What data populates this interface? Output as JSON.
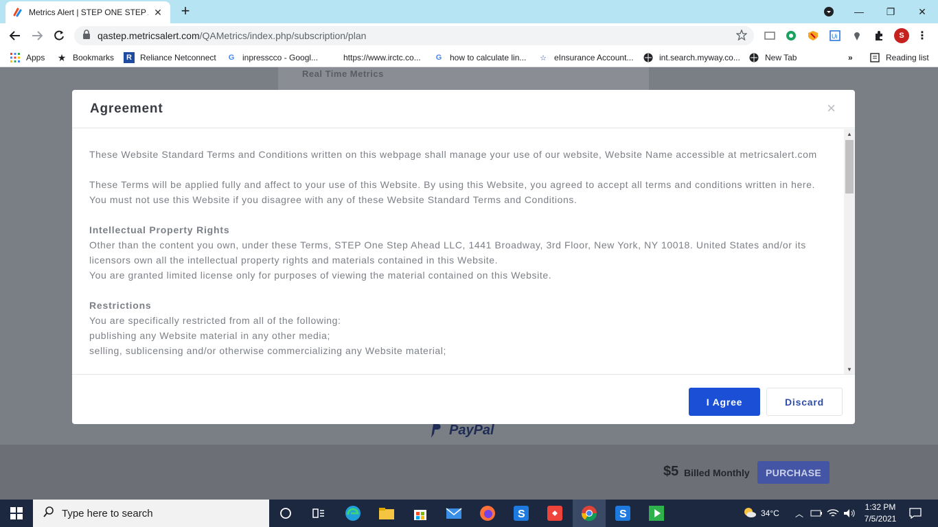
{
  "browser": {
    "tab_title": "Metrics Alert | STEP ONE STEP AHEAD",
    "url_host": "qastep.metricsalert.com",
    "url_path": "/QAMetrics/index.php/subscription/plan"
  },
  "bookmarks": [
    {
      "label": "Apps"
    },
    {
      "label": "Bookmarks"
    },
    {
      "label": "Reliance Netconnect"
    },
    {
      "label": "inpresscco - Googl..."
    },
    {
      "label": "https://www.irctc.co..."
    },
    {
      "label": "how to calculate lin..."
    },
    {
      "label": "eInsurance Account..."
    },
    {
      "label": "int.search.myway.co..."
    },
    {
      "label": "New Tab"
    }
  ],
  "reading_list": "Reading list",
  "page": {
    "section_label": "Real Time Metrics",
    "paypal": "PayPal",
    "price": "$5",
    "billed": "Billed Monthly",
    "purchase": "PURCHASE"
  },
  "modal": {
    "title": "Agreement",
    "close": "×",
    "intro_1": "These Website Standard Terms and Conditions written on this webpage shall manage your use of our website, Website Name accessible at metricsalert.com",
    "intro_2": "These Terms will be applied fully and affect to your use of this Website. By using this Website, you agreed to accept all terms and conditions written in here. You must not use this Website if you disagree with any of these Website Standard Terms and Conditions.",
    "ip_heading": "Intellectual Property Rights",
    "ip_text_1": "Other than the content you own, under these Terms, STEP One Step Ahead LLC, 1441 Broadway, 3rd Floor, New York, NY 10018. United States and/or its licensors own all the intellectual property rights and materials contained in this Website.",
    "ip_text_2": "You are granted limited license only for purposes of viewing the material contained on this Website.",
    "restrictions_heading": "Restrictions",
    "restrictions_intro": "You are specifically restricted from all of the following:",
    "restriction_1": "publishing any Website material in any other media;",
    "restriction_2": "selling, sublicensing and/or otherwise commercializing any Website material;",
    "agree": "I Agree",
    "discard": "Discard"
  },
  "taskbar": {
    "search_placeholder": "Type here to search",
    "temperature": "34°C",
    "time": "1:32 PM",
    "date": "7/5/2021"
  },
  "colors": {
    "primary_button": "#1a4fd6",
    "tab_strip": "#b6e4f3",
    "overlay": "#7a7f86",
    "taskbar": "#1b2840"
  }
}
